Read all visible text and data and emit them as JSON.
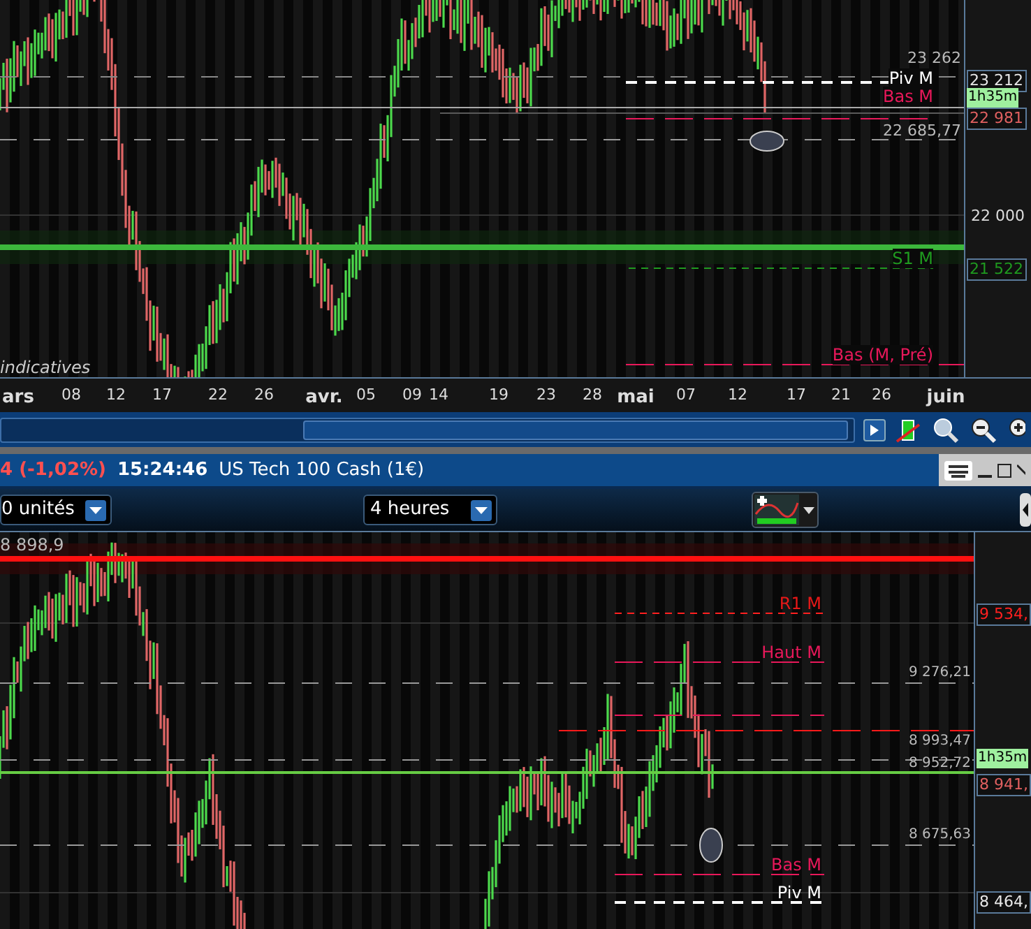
{
  "top_chart": {
    "note": "indicatives",
    "level_labels": [
      {
        "text": "Piv M",
        "color": "#ffffff"
      },
      {
        "text": "Bas M",
        "color": "#e8185a"
      },
      {
        "text": "S1 M",
        "color": "#1f9a1f"
      },
      {
        "text": "Bas (M, Pré)",
        "color": "#e8185a"
      }
    ],
    "price_labels": [
      "23 262",
      "22 685,77"
    ],
    "axis_ticks": [
      "22 000"
    ],
    "axis_tags": [
      {
        "text": "23 212",
        "kind": "price",
        "color": "#e8e8e8"
      },
      {
        "text": "1h35m",
        "kind": "timer"
      },
      {
        "text": "22 981",
        "kind": "price",
        "color": "#e06060"
      },
      {
        "text": "21 522",
        "kind": "price",
        "color": "#1f9a1f"
      }
    ],
    "dates": [
      {
        "text": "ars",
        "major": true
      },
      {
        "text": "08",
        "major": false
      },
      {
        "text": "12",
        "major": false
      },
      {
        "text": "17",
        "major": false
      },
      {
        "text": "22",
        "major": false
      },
      {
        "text": "26",
        "major": false
      },
      {
        "text": "avr.",
        "major": true
      },
      {
        "text": "05",
        "major": false
      },
      {
        "text": "09",
        "major": false
      },
      {
        "text": "14",
        "major": false
      },
      {
        "text": "19",
        "major": false
      },
      {
        "text": "23",
        "major": false
      },
      {
        "text": "28",
        "major": false
      },
      {
        "text": "mai",
        "major": true
      },
      {
        "text": "07",
        "major": false
      },
      {
        "text": "12",
        "major": false
      },
      {
        "text": "17",
        "major": false
      },
      {
        "text": "21",
        "major": false
      },
      {
        "text": "26",
        "major": false
      },
      {
        "text": "juin",
        "major": true
      }
    ]
  },
  "window": {
    "change": "4 (-1,02%)",
    "time": "15:24:46",
    "title": "US Tech 100 Cash (1€)"
  },
  "controls": {
    "dropdowns": [
      {
        "value": "0 unités"
      },
      {
        "value": "4 heures"
      }
    ]
  },
  "bottom_chart": {
    "corner_price": "8 898,9",
    "level_labels": [
      {
        "text": "R1 M",
        "color": "#e81818"
      },
      {
        "text": "Haut M",
        "color": "#e8185a"
      },
      {
        "text": "Bas M",
        "color": "#e8185a"
      },
      {
        "text": "Piv M",
        "color": "#ffffff"
      }
    ],
    "price_labels": [
      "9 276,21",
      "8 993,47",
      "8 952,72",
      "8 675,63"
    ],
    "axis_tags": [
      {
        "text": "9 534,",
        "kind": "price",
        "color": "#ff2020"
      },
      {
        "text": "1h35m",
        "kind": "timer"
      },
      {
        "text": "8 941,",
        "kind": "price",
        "color": "#e06060"
      },
      {
        "text": "8 464,",
        "kind": "price",
        "color": "#e8e8e8"
      }
    ]
  }
}
